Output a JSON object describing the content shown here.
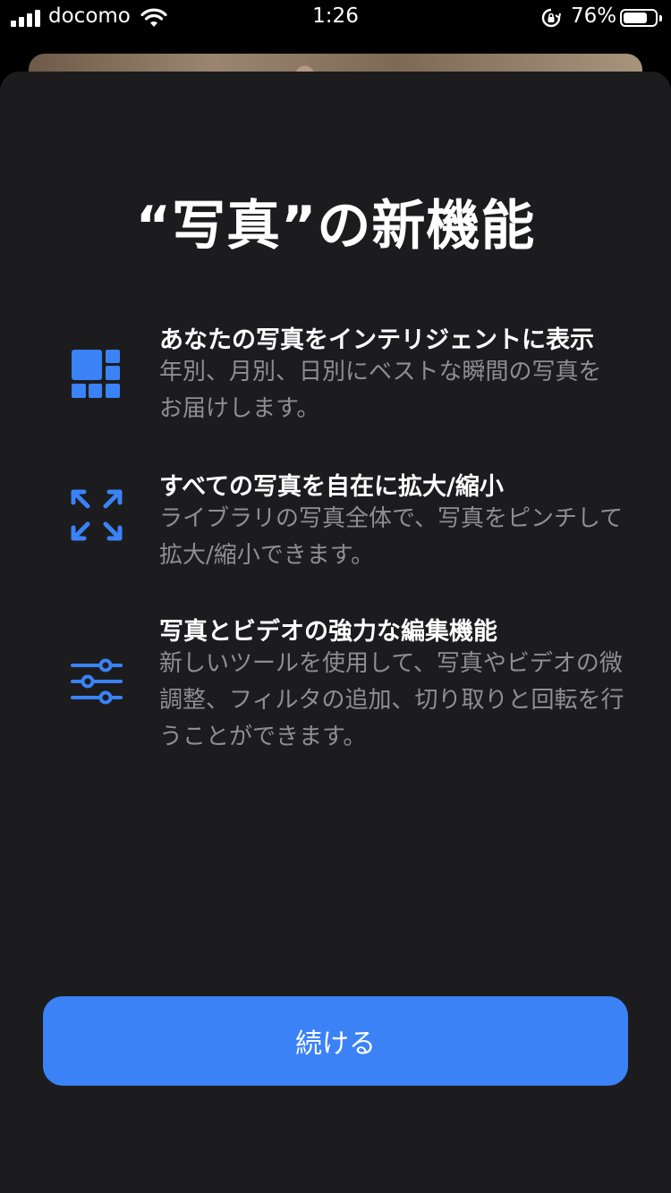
{
  "status_bar": {
    "carrier": "docomo",
    "time": "1:26",
    "battery_percent": "76%",
    "battery_level": 0.76
  },
  "sheet": {
    "title": "“写真”の新機能",
    "features": [
      {
        "icon": "photo-grid-icon",
        "heading": "あなたの写真をインテリジェントに表示",
        "description": "年別、月別、日別にベストな瞬間の写真をお届けします。"
      },
      {
        "icon": "expand-arrows-icon",
        "heading": "すべての写真を自在に拡大/縮小",
        "description": "ライブラリの写真全体で、写真をピンチして拡大/縮小できます。"
      },
      {
        "icon": "sliders-icon",
        "heading": "写真とビデオの強力な編集機能",
        "description": "新しいツールを使用して、写真やビデオの微調整、フィルタの追加、切り取りと回転を行うことができます。"
      }
    ],
    "continue_label": "続ける"
  },
  "colors": {
    "accent": "#3a82f6",
    "sheet_background": "#1c1c1e",
    "secondary_text": "#8e8e93"
  }
}
